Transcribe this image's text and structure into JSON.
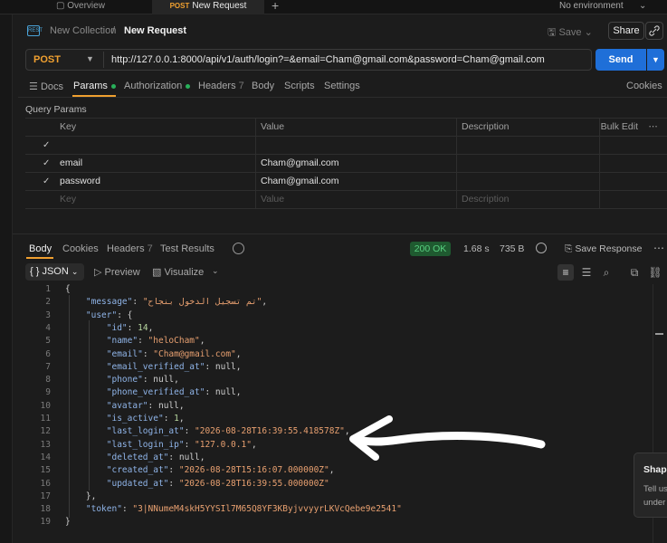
{
  "tabs": {
    "overview": "Overview",
    "active_method": "POST",
    "active_label": "New Request",
    "plus": "+",
    "environment": "No environment",
    "env_caret": "⌄"
  },
  "breadcrumb": {
    "icon_text": "REST",
    "collection": "New Collection",
    "separator": "/",
    "request": "New Request",
    "save": "Save",
    "save_caret": "⌄",
    "share": "Share"
  },
  "url_bar": {
    "method": "POST",
    "url": "http://127.0.0.1:8000/api/v1/auth/login?=&email=Cham@gmail.com&password=Cham@gmail.com",
    "send": "Send"
  },
  "request_tabs": [
    {
      "label": "Docs"
    },
    {
      "label": "Params"
    },
    {
      "label": "Authorization"
    },
    {
      "label": "Headers",
      "count": "7"
    },
    {
      "label": "Body"
    },
    {
      "label": "Scripts"
    },
    {
      "label": "Settings"
    }
  ],
  "cookies": "Cookies",
  "query_params": {
    "title": "Query Params",
    "headers": {
      "key": "Key",
      "value": "Value",
      "description": "Description",
      "bulk_edit": "Bulk Edit"
    },
    "rows": [
      {
        "key": "",
        "value": ""
      },
      {
        "key": "email",
        "value": "Cham@gmail.com"
      },
      {
        "key": "password",
        "value": "Cham@gmail.com"
      }
    ],
    "placeholder": {
      "key": "Key",
      "value": "Value",
      "description": "Description"
    }
  },
  "response_tabs": [
    {
      "label": "Body"
    },
    {
      "label": "Cookies"
    },
    {
      "label": "Headers",
      "count": "7"
    },
    {
      "label": "Test Results"
    }
  ],
  "response_meta": {
    "status": "200 OK",
    "time": "1.68 s",
    "size": "735 B",
    "save_response": "Save Response"
  },
  "response_toolbar": {
    "format": "JSON",
    "preview": "Preview",
    "visualize": "Visualize"
  },
  "code_lines": [
    {
      "n": "1"
    },
    {
      "n": "2"
    },
    {
      "n": "3"
    },
    {
      "n": "4"
    },
    {
      "n": "5"
    },
    {
      "n": "6"
    },
    {
      "n": "7"
    },
    {
      "n": "8"
    },
    {
      "n": "9"
    },
    {
      "n": "10"
    },
    {
      "n": "11"
    },
    {
      "n": "12"
    },
    {
      "n": "13"
    },
    {
      "n": "14"
    },
    {
      "n": "15"
    },
    {
      "n": "16"
    },
    {
      "n": "17"
    },
    {
      "n": "18"
    },
    {
      "n": "19"
    }
  ],
  "json": {
    "message_key": "\"message\"",
    "message_val": "\"تم تسجيل الدخول بنجاح\"",
    "user_key": "\"user\"",
    "id": "14",
    "name": "\"heloCham\"",
    "email": "\"Cham@gmail.com\"",
    "email_verified_at": "null",
    "phone": "null",
    "phone_verified_at": "null",
    "avatar": "null",
    "is_active": "1",
    "last_login_at": "\"2026-08-28T16:39:55.418578Z\"",
    "last_login_ip": "\"127.0.0.1\"",
    "deleted_at": "null",
    "created_at": "\"2026-08-28T15:16:07.000000Z\"",
    "updated_at": "\"2026-08-28T16:39:55.000000Z\"",
    "token": "\"3|NNumeM4skH5YYSIl7M65Q8YF3KByjvvyyrLKVcQebe9e2541\""
  },
  "popup": {
    "title": "Shape",
    "line1": "Tell us",
    "line2": "under"
  }
}
